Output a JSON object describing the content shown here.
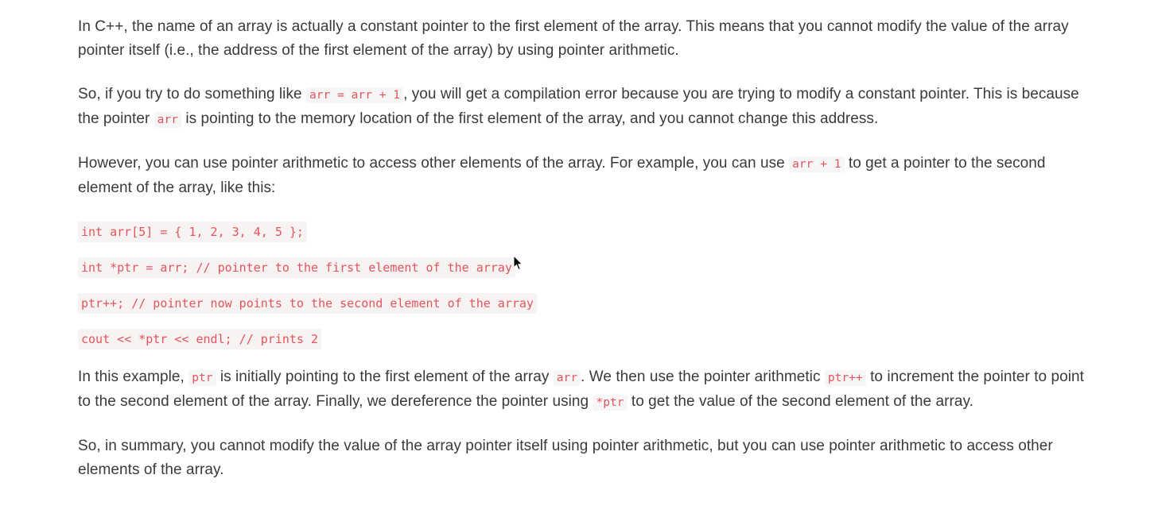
{
  "paragraphs": {
    "p1": {
      "text": "In C++, the name of an array is actually a constant pointer to the first element of the array. This means that you cannot modify the value of the array pointer itself (i.e., the address of the first element of the array) by using pointer arithmetic."
    },
    "p2": {
      "t1": "So, if you try to do something like ",
      "c1": "arr = arr + 1",
      "t2": ", you will get a compilation error because you are trying to modify a constant pointer. This is because the pointer ",
      "c2": "arr",
      "t3": " is pointing to the memory location of the first element of the array, and you cannot change this address."
    },
    "p3": {
      "t1": "However, you can use pointer arithmetic to access other elements of the array. For example, you can use ",
      "c1": "arr + 1",
      "t2": " to get a pointer to the second element of the array, like this:"
    },
    "code_lines": [
      "int arr[5] = { 1, 2, 3, 4, 5 };",
      "int *ptr = arr; // pointer to the first element of the array",
      "ptr++; // pointer now points to the second element of the array",
      "cout << *ptr << endl; // prints 2"
    ],
    "p4": {
      "t1": "In this example, ",
      "c1": "ptr",
      "t2": " is initially pointing to the first element of the array ",
      "c2": "arr",
      "t3": ". We then use the pointer arithmetic ",
      "c3": "ptr++",
      "t4": " to increment the pointer to point to the second element of the array. Finally, we dereference the pointer using ",
      "c4": "*ptr",
      "t5": " to get the value of the second element of the array."
    },
    "p5": {
      "text": "So, in summary, you cannot modify the value of the array pointer itself using pointer arithmetic, but you can use pointer arithmetic to access other elements of the array."
    }
  },
  "colors": {
    "text": "#3a3a3a",
    "code_text": "#e3545c",
    "code_bg": "#f6f6f6"
  },
  "icons": {
    "cursor": "mouse-pointer-icon"
  }
}
